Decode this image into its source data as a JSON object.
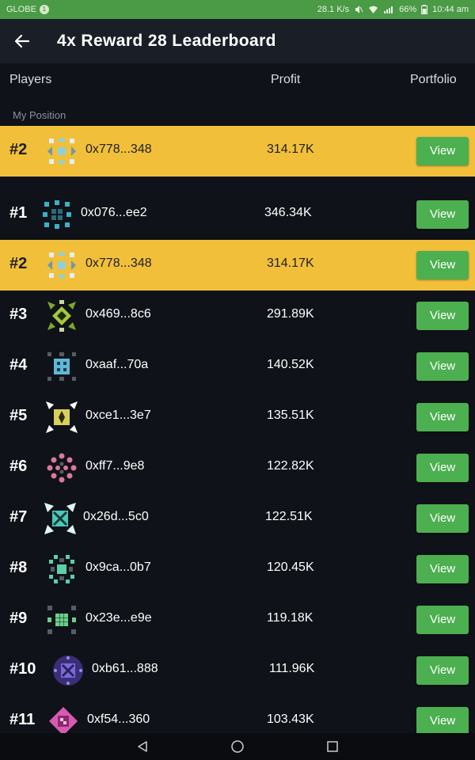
{
  "status_bar": {
    "carrier": "GLOBE",
    "sim_indicator": "1",
    "speed": "28.1 K/s",
    "battery": "66%",
    "time": "10:44 am"
  },
  "header": {
    "back_icon": "arrow-left-icon",
    "title": "4x Reward 28 Leaderboard"
  },
  "columns": {
    "players": "Players",
    "profit": "Profit",
    "portfolio": "Portfolio"
  },
  "my_position": {
    "label": "My Position",
    "rank": "#2",
    "address": "0x778...348",
    "profit": "314.17K",
    "view_label": "View"
  },
  "rows": [
    {
      "rank": "#1",
      "address": "0x076...ee2",
      "profit": "346.34K",
      "view_label": "View",
      "highlight": false,
      "avatar_color": "#3bb0c8"
    },
    {
      "rank": "#2",
      "address": "0x778...348",
      "profit": "314.17K",
      "view_label": "View",
      "highlight": true,
      "avatar_color": "#8fd0d8"
    },
    {
      "rank": "#3",
      "address": "0x469...8c6",
      "profit": "291.89K",
      "view_label": "View",
      "highlight": false,
      "avatar_color": "#a6c83a"
    },
    {
      "rank": "#4",
      "address": "0xaaf...70a",
      "profit": "140.52K",
      "view_label": "View",
      "highlight": false,
      "avatar_color": "#5fb8d8"
    },
    {
      "rank": "#5",
      "address": "0xce1...3e7",
      "profit": "135.51K",
      "view_label": "View",
      "highlight": false,
      "avatar_color": "#d8d05a"
    },
    {
      "rank": "#6",
      "address": "0xff7...9e8",
      "profit": "122.82K",
      "view_label": "View",
      "highlight": false,
      "avatar_color": "#d87a9a"
    },
    {
      "rank": "#7",
      "address": "0x26d...5c0",
      "profit": "122.51K",
      "view_label": "View",
      "highlight": false,
      "avatar_color": "#4ac8b8"
    },
    {
      "rank": "#8",
      "address": "0x9ca...0b7",
      "profit": "120.45K",
      "view_label": "View",
      "highlight": false,
      "avatar_color": "#5ad0a8"
    },
    {
      "rank": "#9",
      "address": "0x23e...e9e",
      "profit": "119.18K",
      "view_label": "View",
      "highlight": false,
      "avatar_color": "#6ad08a"
    },
    {
      "rank": "#10",
      "address": "0xb61...888",
      "profit": "111.96K",
      "view_label": "View",
      "highlight": false,
      "avatar_color": "#7a6ad8"
    },
    {
      "rank": "#11",
      "address": "0xf54...360",
      "profit": "103.43K",
      "view_label": "View",
      "highlight": false,
      "avatar_color": "#d85ab0"
    }
  ],
  "nav": {
    "back_icon": "triangle-back-icon",
    "home_icon": "circle-home-icon",
    "recents_icon": "square-recents-icon"
  }
}
